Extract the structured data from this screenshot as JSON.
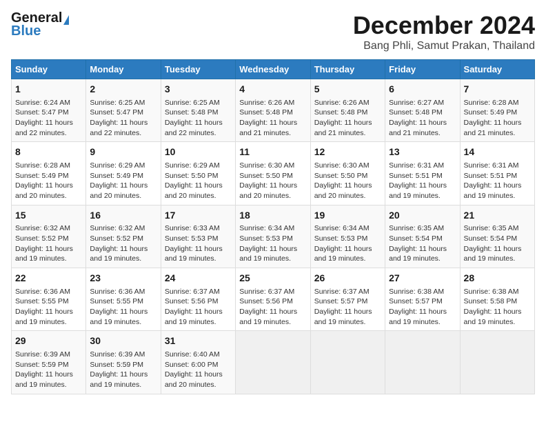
{
  "logo": {
    "line1": "General",
    "line2": "Blue"
  },
  "title": "December 2024",
  "subtitle": "Bang Phli, Samut Prakan, Thailand",
  "days_header": [
    "Sunday",
    "Monday",
    "Tuesday",
    "Wednesday",
    "Thursday",
    "Friday",
    "Saturday"
  ],
  "weeks": [
    [
      {
        "day": "1",
        "info": "Sunrise: 6:24 AM\nSunset: 5:47 PM\nDaylight: 11 hours\nand 22 minutes."
      },
      {
        "day": "2",
        "info": "Sunrise: 6:25 AM\nSunset: 5:47 PM\nDaylight: 11 hours\nand 22 minutes."
      },
      {
        "day": "3",
        "info": "Sunrise: 6:25 AM\nSunset: 5:48 PM\nDaylight: 11 hours\nand 22 minutes."
      },
      {
        "day": "4",
        "info": "Sunrise: 6:26 AM\nSunset: 5:48 PM\nDaylight: 11 hours\nand 21 minutes."
      },
      {
        "day": "5",
        "info": "Sunrise: 6:26 AM\nSunset: 5:48 PM\nDaylight: 11 hours\nand 21 minutes."
      },
      {
        "day": "6",
        "info": "Sunrise: 6:27 AM\nSunset: 5:48 PM\nDaylight: 11 hours\nand 21 minutes."
      },
      {
        "day": "7",
        "info": "Sunrise: 6:28 AM\nSunset: 5:49 PM\nDaylight: 11 hours\nand 21 minutes."
      }
    ],
    [
      {
        "day": "8",
        "info": "Sunrise: 6:28 AM\nSunset: 5:49 PM\nDaylight: 11 hours\nand 20 minutes."
      },
      {
        "day": "9",
        "info": "Sunrise: 6:29 AM\nSunset: 5:49 PM\nDaylight: 11 hours\nand 20 minutes."
      },
      {
        "day": "10",
        "info": "Sunrise: 6:29 AM\nSunset: 5:50 PM\nDaylight: 11 hours\nand 20 minutes."
      },
      {
        "day": "11",
        "info": "Sunrise: 6:30 AM\nSunset: 5:50 PM\nDaylight: 11 hours\nand 20 minutes."
      },
      {
        "day": "12",
        "info": "Sunrise: 6:30 AM\nSunset: 5:50 PM\nDaylight: 11 hours\nand 20 minutes."
      },
      {
        "day": "13",
        "info": "Sunrise: 6:31 AM\nSunset: 5:51 PM\nDaylight: 11 hours\nand 19 minutes."
      },
      {
        "day": "14",
        "info": "Sunrise: 6:31 AM\nSunset: 5:51 PM\nDaylight: 11 hours\nand 19 minutes."
      }
    ],
    [
      {
        "day": "15",
        "info": "Sunrise: 6:32 AM\nSunset: 5:52 PM\nDaylight: 11 hours\nand 19 minutes."
      },
      {
        "day": "16",
        "info": "Sunrise: 6:32 AM\nSunset: 5:52 PM\nDaylight: 11 hours\nand 19 minutes."
      },
      {
        "day": "17",
        "info": "Sunrise: 6:33 AM\nSunset: 5:53 PM\nDaylight: 11 hours\nand 19 minutes."
      },
      {
        "day": "18",
        "info": "Sunrise: 6:34 AM\nSunset: 5:53 PM\nDaylight: 11 hours\nand 19 minutes."
      },
      {
        "day": "19",
        "info": "Sunrise: 6:34 AM\nSunset: 5:53 PM\nDaylight: 11 hours\nand 19 minutes."
      },
      {
        "day": "20",
        "info": "Sunrise: 6:35 AM\nSunset: 5:54 PM\nDaylight: 11 hours\nand 19 minutes."
      },
      {
        "day": "21",
        "info": "Sunrise: 6:35 AM\nSunset: 5:54 PM\nDaylight: 11 hours\nand 19 minutes."
      }
    ],
    [
      {
        "day": "22",
        "info": "Sunrise: 6:36 AM\nSunset: 5:55 PM\nDaylight: 11 hours\nand 19 minutes."
      },
      {
        "day": "23",
        "info": "Sunrise: 6:36 AM\nSunset: 5:55 PM\nDaylight: 11 hours\nand 19 minutes."
      },
      {
        "day": "24",
        "info": "Sunrise: 6:37 AM\nSunset: 5:56 PM\nDaylight: 11 hours\nand 19 minutes."
      },
      {
        "day": "25",
        "info": "Sunrise: 6:37 AM\nSunset: 5:56 PM\nDaylight: 11 hours\nand 19 minutes."
      },
      {
        "day": "26",
        "info": "Sunrise: 6:37 AM\nSunset: 5:57 PM\nDaylight: 11 hours\nand 19 minutes."
      },
      {
        "day": "27",
        "info": "Sunrise: 6:38 AM\nSunset: 5:57 PM\nDaylight: 11 hours\nand 19 minutes."
      },
      {
        "day": "28",
        "info": "Sunrise: 6:38 AM\nSunset: 5:58 PM\nDaylight: 11 hours\nand 19 minutes."
      }
    ],
    [
      {
        "day": "29",
        "info": "Sunrise: 6:39 AM\nSunset: 5:59 PM\nDaylight: 11 hours\nand 19 minutes."
      },
      {
        "day": "30",
        "info": "Sunrise: 6:39 AM\nSunset: 5:59 PM\nDaylight: 11 hours\nand 19 minutes."
      },
      {
        "day": "31",
        "info": "Sunrise: 6:40 AM\nSunset: 6:00 PM\nDaylight: 11 hours\nand 20 minutes."
      },
      {
        "day": "",
        "info": ""
      },
      {
        "day": "",
        "info": ""
      },
      {
        "day": "",
        "info": ""
      },
      {
        "day": "",
        "info": ""
      }
    ]
  ]
}
